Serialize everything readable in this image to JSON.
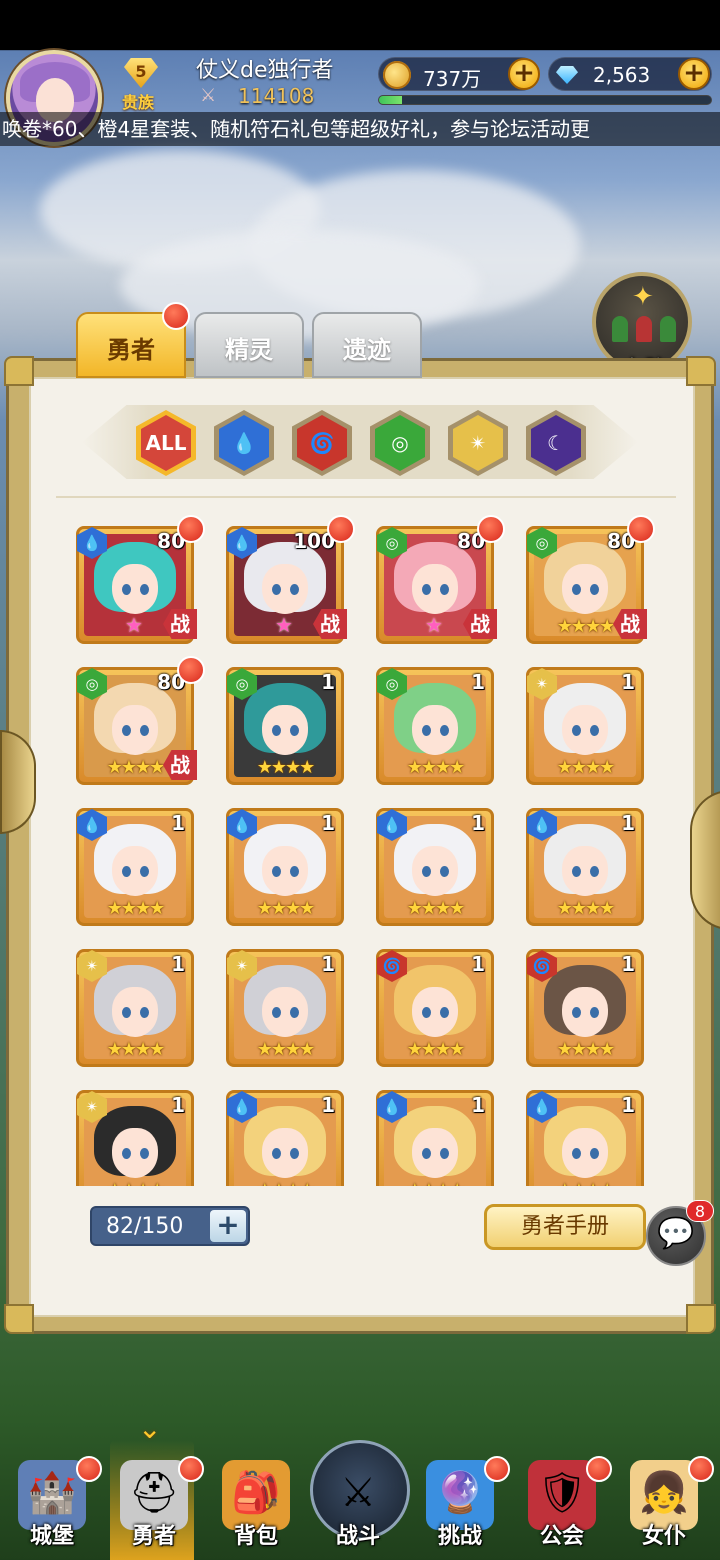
{
  "player": {
    "name": "仗义de独行者",
    "vip_level": "5",
    "vip_label": "贵族",
    "power": "114108",
    "exp_progress": 0.07
  },
  "resources": {
    "gold": "737万",
    "diamonds": "2,563"
  },
  "marquee": "唤卷*60、橙4星套装、随机符石礼包等超级好礼，参与论坛活动更",
  "formation": {
    "label": "布阵"
  },
  "tabs": [
    {
      "label": "勇者",
      "active": true
    },
    {
      "label": "精灵",
      "active": false
    },
    {
      "label": "遗迹",
      "active": false
    }
  ],
  "filters": [
    {
      "label": "ALL",
      "icon": "all-icon",
      "color": "#d4463a"
    },
    {
      "label": "",
      "icon": "water-element-icon",
      "color": "#2f6fd6"
    },
    {
      "label": "",
      "icon": "fire-element-icon",
      "color": "#c8362c"
    },
    {
      "label": "",
      "icon": "wind-element-icon",
      "color": "#3aa83a"
    },
    {
      "label": "",
      "icon": "light-element-icon",
      "color": "#e6c04a"
    },
    {
      "label": "",
      "icon": "dark-element-icon",
      "color": "#4b2f8f"
    }
  ],
  "heroes": [
    {
      "element": "water",
      "level": "80",
      "stars": 1,
      "star_type": "pink",
      "battle": "战",
      "new": true,
      "hair": "#3fc7c0",
      "bg": "#b5323a"
    },
    {
      "element": "water",
      "level": "100",
      "stars": 1,
      "star_type": "pink",
      "battle": "战",
      "new": true,
      "hair": "#e9e9ee",
      "bg": "#7c2b34"
    },
    {
      "element": "wind",
      "level": "80",
      "stars": 1,
      "star_type": "pink",
      "battle": "战",
      "new": true,
      "hair": "#f4a9b7",
      "bg": "#c9484f"
    },
    {
      "element": "wind",
      "level": "80",
      "stars": 4,
      "star_type": "gold",
      "battle": "战",
      "new": true,
      "hair": "#f1d29a",
      "bg": "#e6a24e"
    },
    {
      "element": "wind",
      "level": "80",
      "stars": 4,
      "star_type": "gold",
      "battle": "战",
      "new": true,
      "hair": "#f3d8b0",
      "bg": "#d99a4b"
    },
    {
      "element": "wind",
      "level": "1",
      "stars": 4,
      "star_type": "gold",
      "battle": "",
      "new": false,
      "hair": "#2f9a9a",
      "bg": "#3a3a3a"
    },
    {
      "element": "wind",
      "level": "1",
      "stars": 4,
      "star_type": "gold",
      "battle": "",
      "new": false,
      "hair": "#7fd087",
      "bg": "#e49b4f"
    },
    {
      "element": "light",
      "level": "1",
      "stars": 4,
      "star_type": "gold",
      "battle": "",
      "new": false,
      "hair": "#eeeeee",
      "bg": "#e49b4f"
    },
    {
      "element": "water",
      "level": "1",
      "stars": 4,
      "star_type": "gold",
      "battle": "",
      "new": false,
      "hair": "#f2f2f5",
      "bg": "#e49b4f"
    },
    {
      "element": "water",
      "level": "1",
      "stars": 4,
      "star_type": "gold",
      "battle": "",
      "new": false,
      "hair": "#f2f2f5",
      "bg": "#e49b4f"
    },
    {
      "element": "water",
      "level": "1",
      "stars": 4,
      "star_type": "gold",
      "battle": "",
      "new": false,
      "hair": "#f2f2f5",
      "bg": "#e49b4f"
    },
    {
      "element": "water",
      "level": "1",
      "stars": 4,
      "star_type": "gold",
      "battle": "",
      "new": false,
      "hair": "#ededed",
      "bg": "#e49b4f"
    },
    {
      "element": "light",
      "level": "1",
      "stars": 4,
      "star_type": "gold",
      "battle": "",
      "new": false,
      "hair": "#d0d0d6",
      "bg": "#e49b4f"
    },
    {
      "element": "light",
      "level": "1",
      "stars": 4,
      "star_type": "gold",
      "battle": "",
      "new": false,
      "hair": "#d0d0d6",
      "bg": "#e49b4f"
    },
    {
      "element": "fire",
      "level": "1",
      "stars": 4,
      "star_type": "gold",
      "battle": "",
      "new": false,
      "hair": "#f1c46a",
      "bg": "#e49b4f"
    },
    {
      "element": "fire",
      "level": "1",
      "stars": 4,
      "star_type": "gold",
      "battle": "",
      "new": false,
      "hair": "#6b5546",
      "bg": "#e49b4f"
    },
    {
      "element": "light",
      "level": "1",
      "stars": 4,
      "star_type": "gold",
      "battle": "",
      "new": false,
      "hair": "#2b2b2b",
      "bg": "#e49b4f"
    },
    {
      "element": "water",
      "level": "1",
      "stars": 4,
      "star_type": "gold",
      "battle": "",
      "new": false,
      "hair": "#f3d27c",
      "bg": "#e49b4f"
    },
    {
      "element": "water",
      "level": "1",
      "stars": 4,
      "star_type": "gold",
      "battle": "",
      "new": false,
      "hair": "#f3d27c",
      "bg": "#e49b4f"
    },
    {
      "element": "water",
      "level": "1",
      "stars": 4,
      "star_type": "gold",
      "battle": "",
      "new": false,
      "hair": "#f3d27c",
      "bg": "#e49b4f"
    }
  ],
  "capacity": {
    "text": "82/150"
  },
  "handbook": {
    "label": "勇者手册"
  },
  "chat": {
    "count": "8"
  },
  "nav": [
    {
      "label": "城堡",
      "icon": "castle-icon",
      "dot": true
    },
    {
      "label": "勇者",
      "icon": "hero-helmet-icon",
      "dot": true,
      "active": true
    },
    {
      "label": "背包",
      "icon": "backpack-chest-icon",
      "dot": false
    },
    {
      "label": "战斗",
      "icon": "crossed-swords-icon",
      "dot": false
    },
    {
      "label": "挑战",
      "icon": "challenge-orb-icon",
      "dot": true
    },
    {
      "label": "公会",
      "icon": "guild-shield-icon",
      "dot": true
    },
    {
      "label": "女仆",
      "icon": "maid-icon",
      "dot": true
    }
  ]
}
